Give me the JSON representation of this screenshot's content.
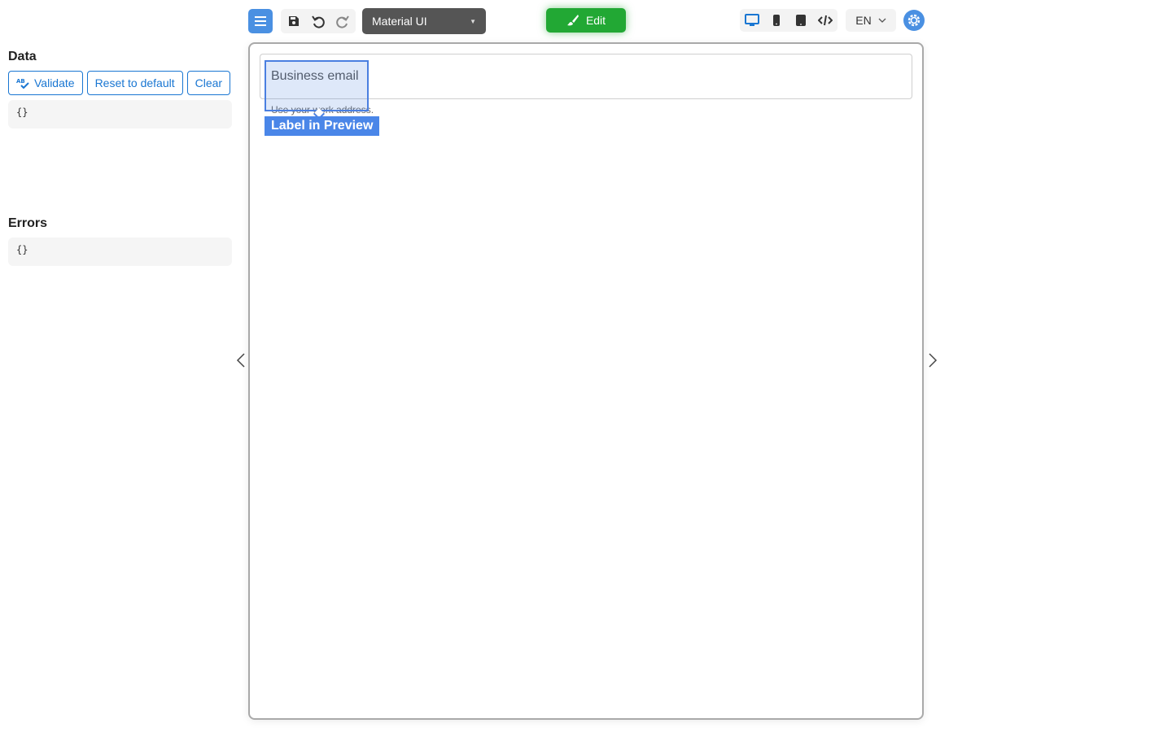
{
  "left_panel": {
    "data_title": "Data",
    "buttons": {
      "validate": "Validate",
      "reset": "Reset to default",
      "clear": "Clear"
    },
    "data_value": "{}",
    "errors_title": "Errors",
    "errors_value": "{}"
  },
  "toolbar": {
    "theme": "Material UI",
    "edit_label": "Edit",
    "language": "EN",
    "icons": [
      "menu-icon",
      "save-icon",
      "undo-icon",
      "redo-icon",
      "brush-icon",
      "desktop-icon",
      "mobile-icon",
      "tablet-icon",
      "code-icon",
      "chevron-down-icon",
      "gear-icon"
    ]
  },
  "preview": {
    "field_label": "Business email",
    "helper_text": "Use your work address.",
    "highlight_tag": "Label in Preview"
  },
  "colors": {
    "accent": "#4a90e2",
    "edit_green": "#22a834",
    "link_blue": "#1976d2",
    "highlight": "#4a86e8"
  }
}
